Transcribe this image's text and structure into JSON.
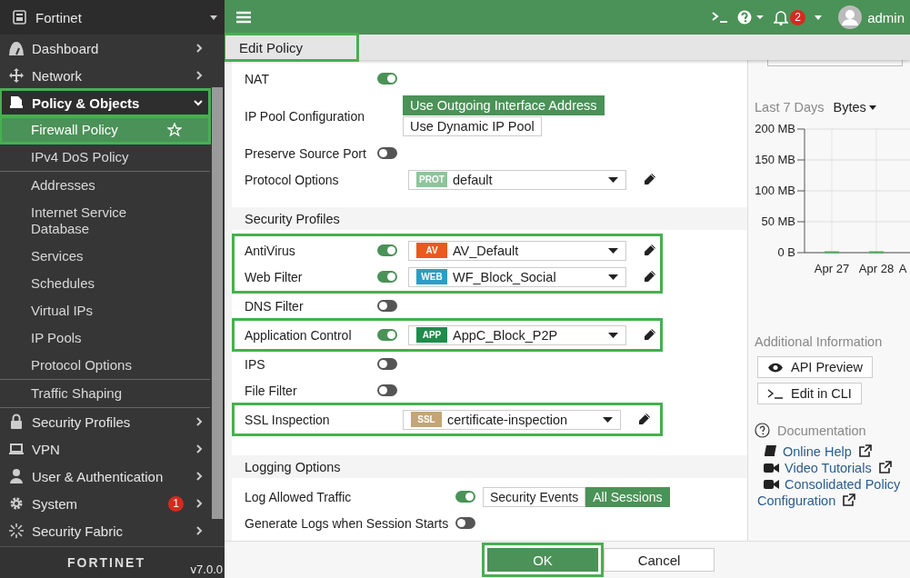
{
  "sidebar": {
    "brand": "Fortinet",
    "items": [
      {
        "label": "Dashboard",
        "expanded": false,
        "highlighted": false
      },
      {
        "label": "Network",
        "expanded": false,
        "highlighted": false
      },
      {
        "label": "Policy & Objects",
        "expanded": true,
        "highlighted": true,
        "groups": [
          [
            {
              "label": "Firewall Policy",
              "selected": true,
              "highlighted": true
            },
            {
              "label": "IPv4 DoS Policy",
              "selected": false,
              "highlighted": false
            }
          ],
          [
            {
              "label": "Addresses",
              "selected": false,
              "highlighted": false
            },
            {
              "label": "Internet Service Database",
              "selected": false,
              "highlighted": false
            },
            {
              "label": "Services",
              "selected": false,
              "highlighted": false
            },
            {
              "label": "Schedules",
              "selected": false,
              "highlighted": false
            },
            {
              "label": "Virtual IPs",
              "selected": false,
              "highlighted": false
            },
            {
              "label": "IP Pools",
              "selected": false,
              "highlighted": false
            },
            {
              "label": "Protocol Options",
              "selected": false,
              "highlighted": false
            }
          ],
          [
            {
              "label": "Traffic Shaping",
              "selected": false,
              "highlighted": false
            }
          ]
        ]
      },
      {
        "label": "Security Profiles",
        "expanded": false,
        "highlighted": false
      },
      {
        "label": "VPN",
        "expanded": false,
        "highlighted": false
      },
      {
        "label": "User & Authentication",
        "expanded": false,
        "highlighted": false
      },
      {
        "label": "System",
        "expanded": false,
        "highlighted": false,
        "badge": "1"
      },
      {
        "label": "Security Fabric",
        "expanded": false,
        "highlighted": false
      }
    ],
    "logo": "FORTINET",
    "version": "v7.0.0"
  },
  "header": {
    "notifications": "2",
    "user": "admin"
  },
  "tab": {
    "label": "Edit Policy",
    "highlighted": true
  },
  "sections": [
    {
      "kind": "nat",
      "blocks": [
        {
          "highlighted": false,
          "rows": [
            {
              "kind": "toggle",
              "label": "NAT",
              "on": true
            },
            {
              "kind": "radio",
              "label": "IP Pool Configuration",
              "options": [
                {
                  "label": "Use Outgoing Interface Address",
                  "selected": true
                },
                {
                  "label": "Use Dynamic IP Pool",
                  "selected": false
                }
              ]
            },
            {
              "kind": "toggle",
              "label": "Preserve Source Port",
              "on": false
            },
            {
              "kind": "select",
              "label": "Protocol Options",
              "badge": "PROT",
              "color": "#8dc59b",
              "value": "default"
            }
          ]
        }
      ]
    },
    {
      "kind": "profiles",
      "title": "Security Profiles",
      "blocks": [
        {
          "highlighted": true,
          "rows": [
            {
              "kind": "toggle-select",
              "label": "AntiVirus",
              "on": true,
              "badge": "AV",
              "color": "#ea5a1c",
              "value": "AV_Default"
            },
            {
              "kind": "toggle-select",
              "label": "Web Filter",
              "on": true,
              "badge": "WEB",
              "color": "#2c9ec4",
              "value": "WF_Block_Social"
            }
          ]
        },
        {
          "highlighted": false,
          "rows": [
            {
              "kind": "toggle",
              "label": "DNS Filter",
              "on": false
            }
          ]
        },
        {
          "highlighted": true,
          "rows": [
            {
              "kind": "toggle-select",
              "label": "Application Control",
              "on": true,
              "badge": "APP",
              "color": "#1f8c4c",
              "value": "AppC_Block_P2P"
            }
          ]
        },
        {
          "highlighted": false,
          "rows": [
            {
              "kind": "toggle",
              "label": "IPS",
              "on": false
            },
            {
              "kind": "toggle",
              "label": "File Filter",
              "on": false
            }
          ]
        },
        {
          "highlighted": true,
          "rows": [
            {
              "kind": "select",
              "label": "SSL Inspection",
              "badge": "SSL",
              "color": "#c4a574",
              "value": "certificate-inspection"
            }
          ]
        }
      ]
    },
    {
      "kind": "logging",
      "title": "Logging Options",
      "blocks": [
        {
          "highlighted": false,
          "rows": [
            {
              "kind": "toggle-segment",
              "label": "Log Allowed Traffic",
              "on": true,
              "options": [
                {
                  "label": "Security Events",
                  "selected": false
                },
                {
                  "label": "All Sessions",
                  "selected": true
                }
              ]
            },
            {
              "kind": "toggle",
              "label": "Generate Logs when Session Starts",
              "on": false
            }
          ]
        }
      ]
    }
  ],
  "panel": {
    "period": "Last 7 Days",
    "metric": "Bytes",
    "chart_data": {
      "type": "bar",
      "categories": [
        "Apr 27",
        "Apr 28",
        "A"
      ],
      "values": [
        0,
        0,
        null
      ],
      "grid": true,
      "ylim": [
        0,
        200
      ],
      "yticks": [
        {
          "value": 0,
          "label": "0 B"
        },
        {
          "value": 50,
          "label": "50 MB"
        },
        {
          "value": 100,
          "label": "100 MB"
        },
        {
          "value": 150,
          "label": "150 MB"
        },
        {
          "value": 200,
          "label": "200 MB"
        }
      ]
    },
    "info_title": "Additional Information",
    "buttons": [
      "API Preview",
      "Edit in CLI"
    ],
    "docs_title": "Documentation",
    "links": [
      "Online Help",
      "Video Tutorials",
      "Consolidated Policy Configuration"
    ]
  },
  "footer": {
    "buttons": [
      {
        "label": "OK",
        "primary": true,
        "highlighted": true
      },
      {
        "label": "Cancel",
        "primary": false,
        "highlighted": false
      }
    ]
  }
}
